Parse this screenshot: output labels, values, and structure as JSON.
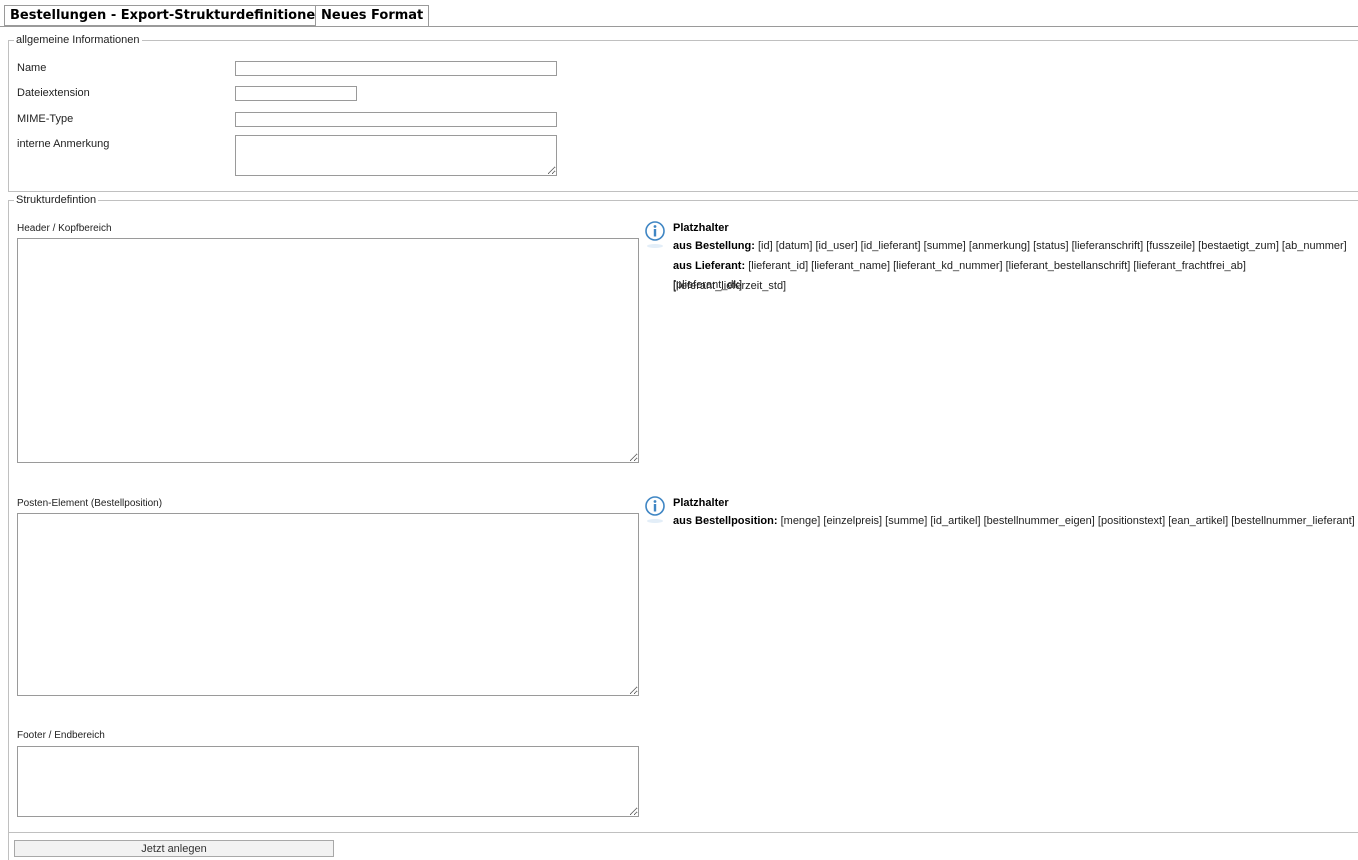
{
  "tabs": [
    {
      "label": "Bestellungen - Export-Strukturdefinitionen",
      "active": false
    },
    {
      "label": "Neues Format",
      "active": true
    }
  ],
  "general": {
    "legend": "allgemeine Informationen",
    "name_label": "Name",
    "name_value": "",
    "extension_label": "Dateiextension",
    "extension_value": "",
    "mime_label": "MIME-Type",
    "mime_value": "",
    "note_label": "interne Anmerkung",
    "note_value": ""
  },
  "structure": {
    "legend": "Strukturdefintion",
    "header_label": "Header / Kopfbereich",
    "header_value": "",
    "item_label": "Posten-Element (Bestellposition)",
    "item_value": "",
    "footer_label": "Footer / Endbereich",
    "footer_value": ""
  },
  "placeholders_header": {
    "title": "Platzhalter",
    "order_prefix": "aus Bestellung:",
    "order_tokens": "[id] [datum] [id_user] [id_lieferant] [summe] [anmerkung] [status] [lieferanschrift] [fusszeile] [bestaetigt_zum] [ab_nummer]",
    "supplier_prefix": "aus Lieferant:",
    "supplier_tokens": "[lieferant_id] [lieferant_name] [lieferant_kd_nummer] [lieferant_bestellanschrift] [lieferant_frachtfrei_ab] [lieferant_lieferzeit_std]",
    "supplier_tokens_cont": "[plieferant_dk]"
  },
  "placeholders_item": {
    "title": "Platzhalter",
    "position_prefix": "aus Bestellposition:",
    "position_tokens": "[menge] [einzelpreis] [summe] [id_artikel] [bestellnummer_eigen] [positionstext] [ean_artikel] [bestellnummer_lieferant]"
  },
  "submit_label": "Jetzt anlegen",
  "icons": {
    "info": "info-icon",
    "resize": "resize-grip-icon"
  },
  "colors": {
    "border": "#9a9a9a",
    "fieldset_border": "#c0c0c0",
    "info_blue": "#3f86c4"
  }
}
